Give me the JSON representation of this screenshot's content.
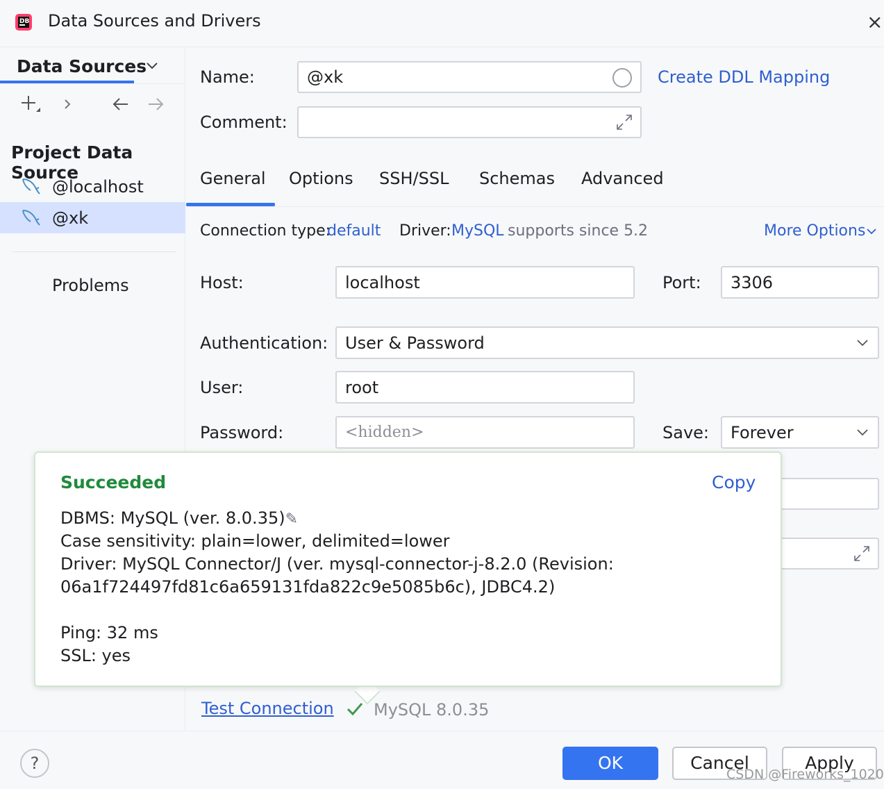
{
  "window": {
    "title": "Data Sources and Drivers",
    "close_icon": "close-icon"
  },
  "sidebar": {
    "header": "Data Sources",
    "section_title": "Project Data Source",
    "items": [
      {
        "label": "@localhost",
        "icon": "mysql-dolphin-icon",
        "selected": false
      },
      {
        "label": "@xk",
        "icon": "mysql-dolphin-icon",
        "selected": true
      }
    ],
    "problems": "Problems"
  },
  "form": {
    "name_label": "Name:",
    "name_value": "@xk",
    "comment_label": "Comment:",
    "comment_value": "",
    "create_ddl": "Create DDL Mapping"
  },
  "tabs": [
    "General",
    "Options",
    "SSH/SSL",
    "Schemas",
    "Advanced"
  ],
  "active_tab": "General",
  "connection": {
    "type_label": "Connection type:",
    "type_value": "default",
    "driver_label": "Driver:",
    "driver_value": "MySQL",
    "driver_note": "supports since 5.2",
    "more_options": "More Options"
  },
  "general": {
    "host_label": "Host:",
    "host_value": "localhost",
    "port_label": "Port:",
    "port_value": "3306",
    "auth_label": "Authentication:",
    "auth_value": "User & Password",
    "user_label": "User:",
    "user_value": "root",
    "password_label": "Password:",
    "password_placeholder": "<hidden>",
    "save_label": "Save:",
    "save_value": "Forever"
  },
  "popup": {
    "status": "Succeeded",
    "copy": "Copy",
    "lines": [
      "DBMS: MySQL (ver. 8.0.35)",
      "Case sensitivity: plain=lower, delimited=lower",
      "Driver: MySQL Connector/J (ver. mysql-connector-j-8.2.0 (Revision:",
      "06a1f724497fd81c6a659131fda822c9e5085b6c), JDBC4.2)",
      "Ping: 32 ms",
      "SSL: yes"
    ]
  },
  "test": {
    "link": "Test Connection",
    "version": "MySQL 8.0.35"
  },
  "footer": {
    "help": "?",
    "ok": "OK",
    "cancel": "Cancel",
    "apply": "Apply",
    "watermark": "CSDN @Fireworks_1020"
  },
  "colors": {
    "accent": "#3574f0",
    "link": "#2f5fd0",
    "success": "#208a3c",
    "selection": "#d5e1ff"
  }
}
